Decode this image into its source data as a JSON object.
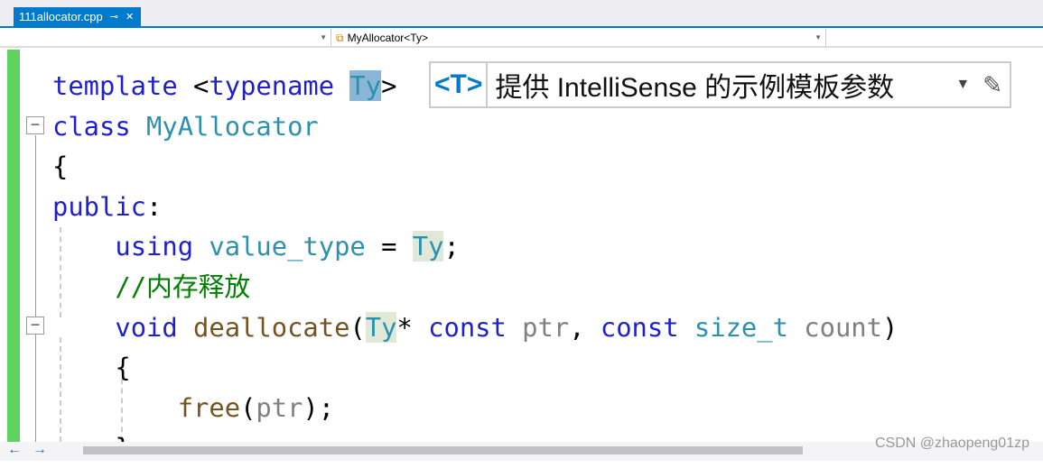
{
  "tab": {
    "title": "111allocator.cpp",
    "pin": "⊸",
    "close": "✕"
  },
  "navbar": {
    "scope_left": "",
    "scope_mid": "MyAllocator<Ty>",
    "scope_right": ""
  },
  "hint": {
    "tag": "<T>",
    "text": "提供 IntelliSense 的示例模板参数",
    "dropdown": "▼",
    "edit": "✎"
  },
  "code": [
    [
      [
        "kw",
        "template "
      ],
      [
        "pl",
        "<"
      ],
      [
        "kw",
        "typename "
      ],
      [
        "ty hl",
        "Ty"
      ],
      [
        "pl",
        ">"
      ]
    ],
    [
      [
        "kw",
        "class "
      ],
      [
        "ty",
        "MyAllocator"
      ]
    ],
    [
      [
        "pl",
        "{"
      ]
    ],
    [
      [
        "kw",
        "public"
      ],
      [
        "pl",
        ":"
      ]
    ],
    [
      [
        "pl",
        "    "
      ],
      [
        "kw",
        "using "
      ],
      [
        "ty",
        "value_type"
      ],
      [
        "pl",
        " = "
      ],
      [
        "ty hl2",
        "Ty"
      ],
      [
        "pl",
        ";"
      ]
    ],
    [
      [
        "pl",
        "    "
      ],
      [
        "cm",
        "//内存释放"
      ]
    ],
    [
      [
        "pl",
        "    "
      ],
      [
        "kw",
        "void "
      ],
      [
        "fn",
        "deallocate"
      ],
      [
        "pl",
        "("
      ],
      [
        "ty hl2",
        "Ty"
      ],
      [
        "pl",
        "* "
      ],
      [
        "kw",
        "const "
      ],
      [
        "pa",
        "ptr"
      ],
      [
        "pl",
        ", "
      ],
      [
        "kw",
        "const "
      ],
      [
        "ty",
        "size_t "
      ],
      [
        "pa",
        "count"
      ],
      [
        "pl",
        ")"
      ]
    ],
    [
      [
        "pl",
        "    {"
      ]
    ],
    [
      [
        "pl",
        "        "
      ],
      [
        "fn",
        "free"
      ],
      [
        "pl",
        "("
      ],
      [
        "pa",
        "ptr"
      ],
      [
        "pl",
        ");"
      ]
    ],
    [
      [
        "pl",
        "    }"
      ]
    ]
  ],
  "bottom": {
    "back": "←",
    "forward": "→"
  },
  "watermark": "CSDN @zhaopeng01zp"
}
